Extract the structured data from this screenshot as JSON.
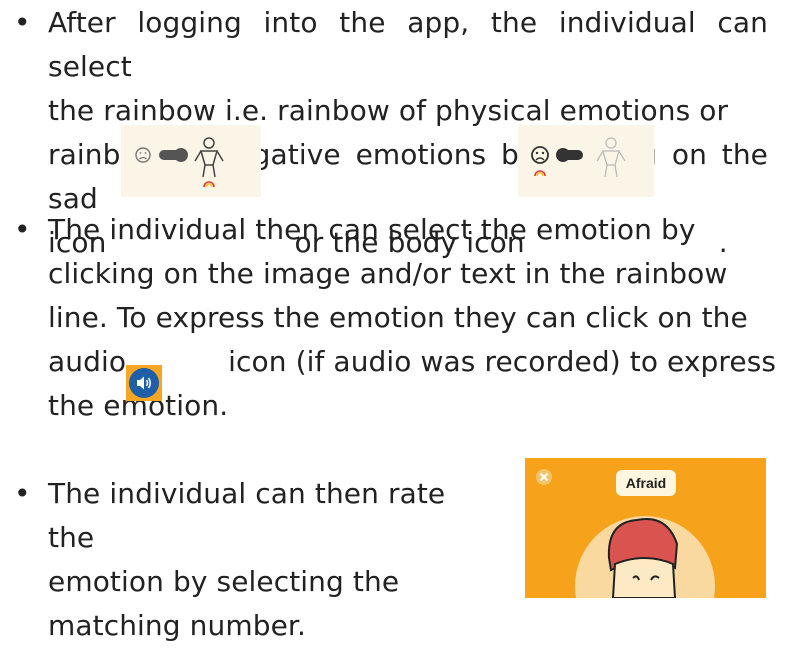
{
  "bullets": [
    {
      "line1": "After logging into the app, the individual can select",
      "line2": "the rainbow i.e. rainbow of physical emotions or",
      "line3": "rainbow of negative emotions by clicking on the sad",
      "line4_a": "icon",
      "line4_b": "or the body icon",
      "line4_c": "."
    },
    {
      "line1": "The individual then can select the emotion by",
      "line2": "clicking on the image and/or text in the rainbow",
      "line3": "line. To express the emotion they can click on the",
      "line4_a": "audio",
      "line4_b": "icon (if audio was recorded) to express",
      "line5": "the emotion."
    },
    {
      "line1": "The individual can then rate the",
      "line2": "emotion by selecting the",
      "line3": "matching number."
    }
  ],
  "card": {
    "label": "Afraid",
    "close_icon": "close-icon",
    "accent_color": "#f7a21b"
  },
  "icons": {
    "sad_face": "sad-face-icon",
    "toggle": "toggle-switch-icon",
    "body": "body-figure-icon",
    "rainbow": "rainbow-icon",
    "speaker": "speaker-icon"
  }
}
